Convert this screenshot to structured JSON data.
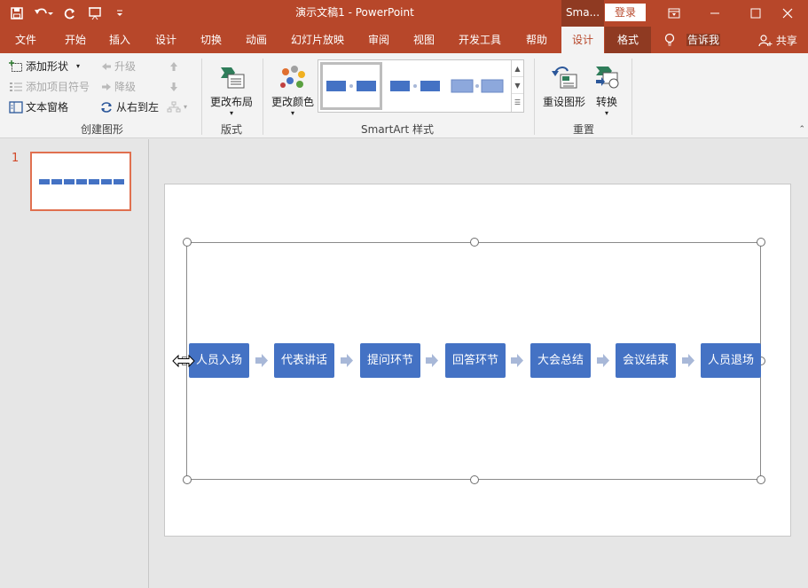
{
  "titlebar": {
    "title": "演示文稿1  -  PowerPoint",
    "context_tab": "Sma...",
    "login": "登录"
  },
  "tabs": [
    {
      "label": "文件"
    },
    {
      "label": "开始"
    },
    {
      "label": "插入"
    },
    {
      "label": "设计"
    },
    {
      "label": "切换"
    },
    {
      "label": "动画"
    },
    {
      "label": "幻灯片放映"
    },
    {
      "label": "审阅"
    },
    {
      "label": "视图"
    },
    {
      "label": "开发工具"
    },
    {
      "label": "帮助"
    },
    {
      "label": "设计"
    },
    {
      "label": "格式"
    }
  ],
  "tellme": "告诉我",
  "share": "共享",
  "ribbon": {
    "create": {
      "add_shape": "添加形状",
      "add_bullet": "添加项目符号",
      "text_pane": "文本窗格",
      "promote": "升级",
      "demote": "降级",
      "right_to_left": "从右到左",
      "label": "创建图形"
    },
    "layouts": {
      "change_layout": "更改布局",
      "label": "版式"
    },
    "styles": {
      "change_colors": "更改颜色",
      "label": "SmartArt 样式"
    },
    "reset": {
      "reset_graphic": "重设图形",
      "convert": "转换",
      "label": "重置"
    }
  },
  "thumbnail": {
    "slide_number": "1"
  },
  "smartart": {
    "steps": [
      "人员入场",
      "代表讲话",
      "提问环节",
      "回答环节",
      "大会总结",
      "会议结束",
      "人员退场"
    ]
  },
  "colors": {
    "accent": "#b7472a",
    "shape_fill": "#4472c4",
    "arrow": "#a8b8d8"
  }
}
